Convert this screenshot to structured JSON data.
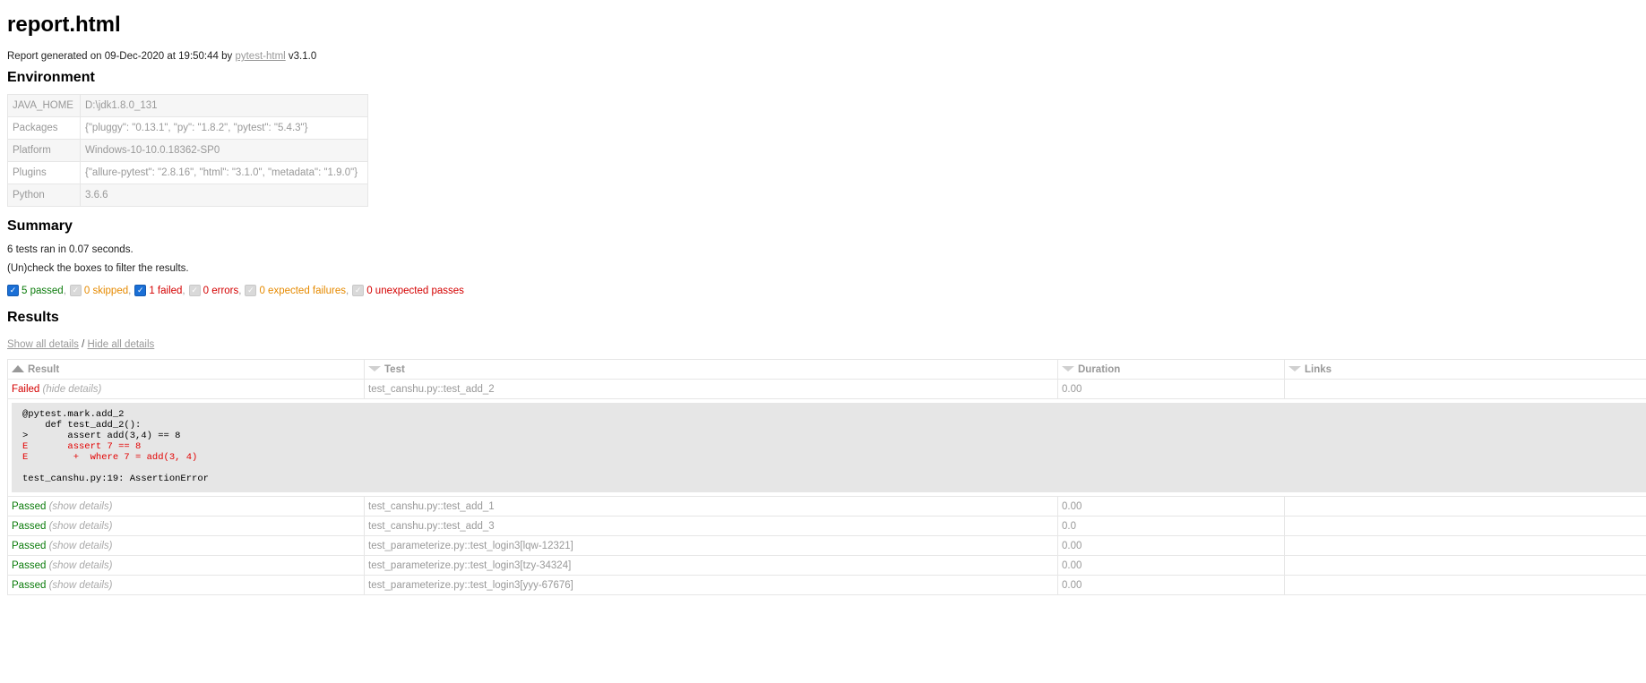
{
  "title": "report.html",
  "meta": {
    "prefix": "Report generated on 09-Dec-2020 at 19:50:44 by ",
    "link": "pytest-html",
    "suffix": " v3.1.0"
  },
  "environment": {
    "heading": "Environment",
    "rows": [
      {
        "key": "JAVA_HOME",
        "value": "D:\\jdk1.8.0_131"
      },
      {
        "key": "Packages",
        "value": "{\"pluggy\": \"0.13.1\", \"py\": \"1.8.2\", \"pytest\": \"5.4.3\"}"
      },
      {
        "key": "Platform",
        "value": "Windows-10-10.0.18362-SP0"
      },
      {
        "key": "Plugins",
        "value": "{\"allure-pytest\": \"2.8.16\", \"html\": \"3.1.0\", \"metadata\": \"1.9.0\"}"
      },
      {
        "key": "Python",
        "value": "3.6.6"
      }
    ]
  },
  "summary": {
    "heading": "Summary",
    "line": "6 tests ran in 0.07 seconds.",
    "hint": "(Un)check the boxes to filter the results.",
    "filters": [
      {
        "label": "5 passed",
        "checked": true,
        "cls": "passed"
      },
      {
        "label": "0 skipped",
        "checked": false,
        "cls": "skipped"
      },
      {
        "label": "1 failed",
        "checked": true,
        "cls": "failed"
      },
      {
        "label": "0 errors",
        "checked": false,
        "cls": "error"
      },
      {
        "label": "0 expected failures",
        "checked": false,
        "cls": "xfailed"
      },
      {
        "label": "0 unexpected passes",
        "checked": false,
        "cls": "xpassed"
      }
    ]
  },
  "results": {
    "heading": "Results",
    "show_all": "Show all details",
    "divider": " / ",
    "hide_all": "Hide all details",
    "columns": [
      "Result",
      "Test",
      "Duration",
      "Links"
    ],
    "failed_row": {
      "result": "Failed",
      "toggle": "(hide details)",
      "test": "test_canshu.py::test_add_2",
      "duration": "0.00",
      "log": [
        {
          "text": "@pytest.mark.add_2",
          "err": false
        },
        {
          "text": "    def test_add_2():",
          "err": false
        },
        {
          "text": ">       assert add(3,4) == 8",
          "err": false
        },
        {
          "text": "E       assert 7 == 8",
          "err": true
        },
        {
          "text": "E        +  where 7 = add(3, 4)",
          "err": true
        },
        {
          "text": "",
          "err": false
        },
        {
          "text": "test_canshu.py:19: AssertionError",
          "err": false
        }
      ]
    },
    "passed_rows": [
      {
        "result": "Passed",
        "toggle": "(show details)",
        "test": "test_canshu.py::test_add_1",
        "duration": "0.00"
      },
      {
        "result": "Passed",
        "toggle": "(show details)",
        "test": "test_canshu.py::test_add_3",
        "duration": "0.0"
      },
      {
        "result": "Passed",
        "toggle": "(show details)",
        "test": "test_parameterize.py::test_login3[lqw-12321]",
        "duration": "0.00"
      },
      {
        "result": "Passed",
        "toggle": "(show details)",
        "test": "test_parameterize.py::test_login3[tzy-34324]",
        "duration": "0.00"
      },
      {
        "result": "Passed",
        "toggle": "(show details)",
        "test": "test_parameterize.py::test_login3[yyy-67676]",
        "duration": "0.00"
      }
    ]
  }
}
